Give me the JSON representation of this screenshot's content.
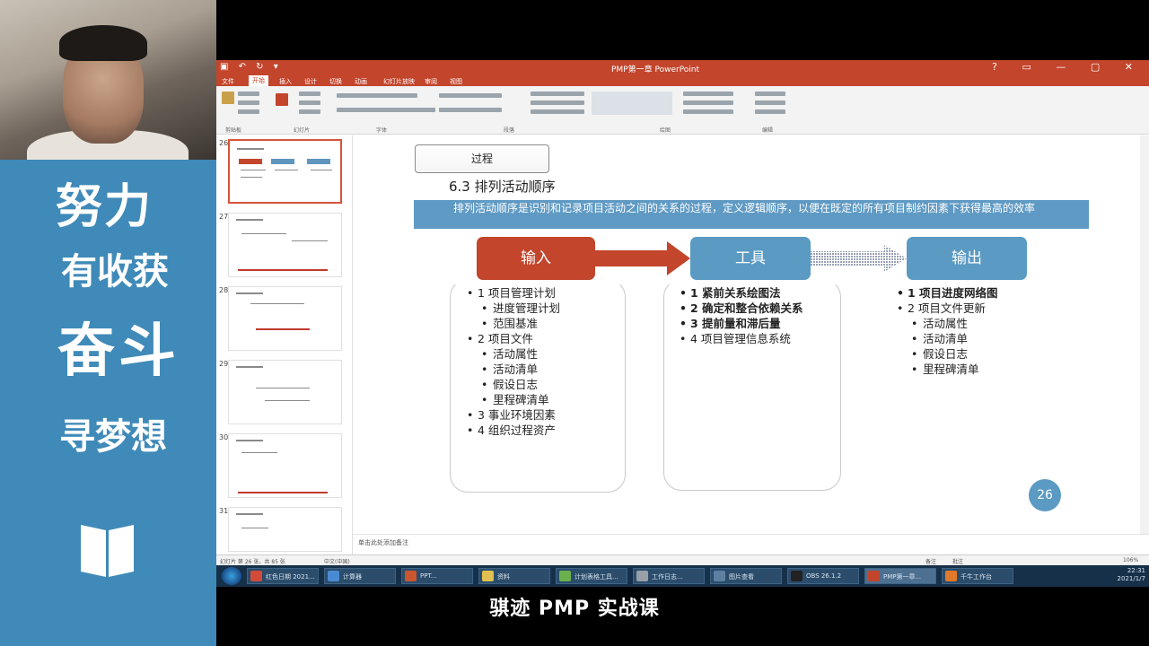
{
  "banner": {
    "line1": "努力",
    "line2": "有收获",
    "line3": "奋斗",
    "line4": "寻梦想"
  },
  "window": {
    "title": "PMP第一章 PowerPoint",
    "quick_access": "▣ ↶ ↻ ▾",
    "controls": "? ▭ — ▢ ✕"
  },
  "ribbon": {
    "tabs": [
      "文件",
      "开始",
      "插入",
      "设计",
      "切换",
      "动画",
      "幻灯片放映",
      "审阅",
      "视图"
    ],
    "active_tab": "开始",
    "groups": [
      "剪贴板",
      "幻灯片",
      "字体",
      "段落",
      "绘图",
      "编辑"
    ]
  },
  "thumbnails": [
    {
      "num": "26",
      "selected": true
    },
    {
      "num": "27",
      "selected": false
    },
    {
      "num": "28",
      "selected": false
    },
    {
      "num": "29",
      "selected": false
    },
    {
      "num": "30",
      "selected": false
    },
    {
      "num": "31",
      "selected": false
    }
  ],
  "slide": {
    "process_tag": "过程",
    "title": "6.3  排列活动顺序",
    "definition": "排列活动顺序是识别和记录项目活动之间的关系的过程，定义逻辑顺序，以便在既定的所有项目制约因素下获得最高的效率",
    "input_header": "输入",
    "tool_header": "工具",
    "output_header": "输出",
    "inputs": [
      {
        "text": "1 项目管理计划",
        "level": 0
      },
      {
        "text": "进度管理计划",
        "level": 1
      },
      {
        "text": "范围基准",
        "level": 1
      },
      {
        "text": "2 项目文件",
        "level": 0
      },
      {
        "text": "活动属性",
        "level": 1
      },
      {
        "text": "活动清单",
        "level": 1
      },
      {
        "text": "假设日志",
        "level": 1
      },
      {
        "text": "里程碑清单",
        "level": 1
      },
      {
        "text": "3 事业环境因素",
        "level": 0
      },
      {
        "text": "4 组织过程资产",
        "level": 0
      }
    ],
    "tools": [
      {
        "text": "1 紧前关系绘图法",
        "bold": true
      },
      {
        "text": "2 确定和整合依赖关系",
        "bold": true
      },
      {
        "text": "3 提前量和滞后量",
        "bold": true
      },
      {
        "text": "4 项目管理信息系统",
        "bold": false
      }
    ],
    "outputs": [
      {
        "text": "1 项目进度网络图",
        "level": 0,
        "bold": true
      },
      {
        "text": "2 项目文件更新",
        "level": 0,
        "bold": false
      },
      {
        "text": "活动属性",
        "level": 1,
        "bold": false
      },
      {
        "text": "活动清单",
        "level": 1,
        "bold": false
      },
      {
        "text": "假设日志",
        "level": 1,
        "bold": false
      },
      {
        "text": "里程碑清单",
        "level": 1,
        "bold": false
      }
    ],
    "page_number": "26"
  },
  "notes": {
    "placeholder": "单击此处添加备注"
  },
  "status": {
    "left": "幻灯片 第 26 张，共 85 张",
    "lang": "中文(中国)",
    "notes_btn": "备注",
    "comments_btn": "批注",
    "zoom": "106%"
  },
  "taskbar": {
    "items": [
      "红色日期 2021...",
      "计算器",
      "PPT...",
      "资料",
      "计划表格工具...",
      "工作日志...",
      "图片查看",
      "OBS 26.1.2",
      "PMP第一章...",
      "千牛工作台"
    ],
    "clock_time": "22:31",
    "clock_date": "2021/1/7"
  },
  "caption": "骐迹 PMP 实战课",
  "colors": {
    "accent_red": "#c2452c",
    "accent_blue": "#5b9ac2",
    "banner_blue": "#3f8ab8"
  }
}
